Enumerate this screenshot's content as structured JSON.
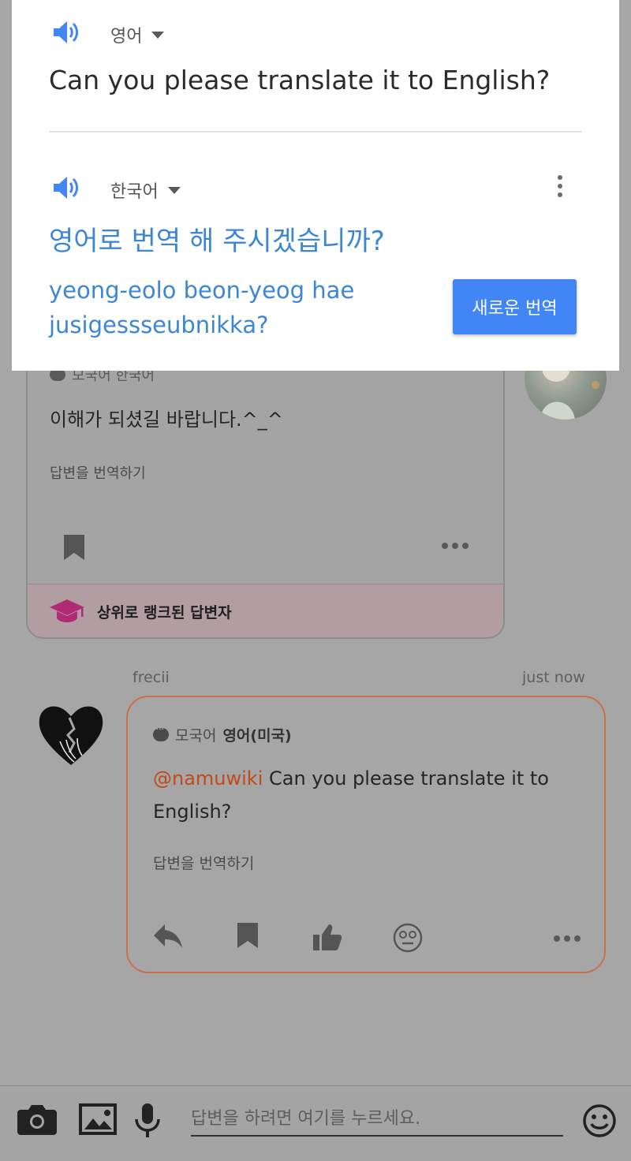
{
  "translation_popup": {
    "source_lang": "영어",
    "source_text": "Can you please translate it to English?",
    "target_lang": "한국어",
    "target_text": "영어로 번역 해 주시겠습니까?",
    "romanized": "yeong-eolo beon-yeog hae jusigessseubnikka?",
    "new_translation_button": "새로운 번역",
    "accent_color": "#4285f4"
  },
  "answer_card": {
    "lang_label": "모국어 한국어",
    "body": "이해가 되셨길 바랍니다.^_^",
    "translate_link": "답변을 번역하기",
    "rank_label": "상위로 랭크된 답변자"
  },
  "message": {
    "username": "frecii",
    "timestamp": "just now",
    "lang_label_prefix": "모국어",
    "lang_label_value": "영어(미국)",
    "mention": "@namuwiki",
    "text": " Can you please translate it to English?",
    "translate_link": "답변을 번역하기"
  },
  "bottom_bar": {
    "reply_placeholder": "답변을 하려면 여기를 누르세요."
  }
}
